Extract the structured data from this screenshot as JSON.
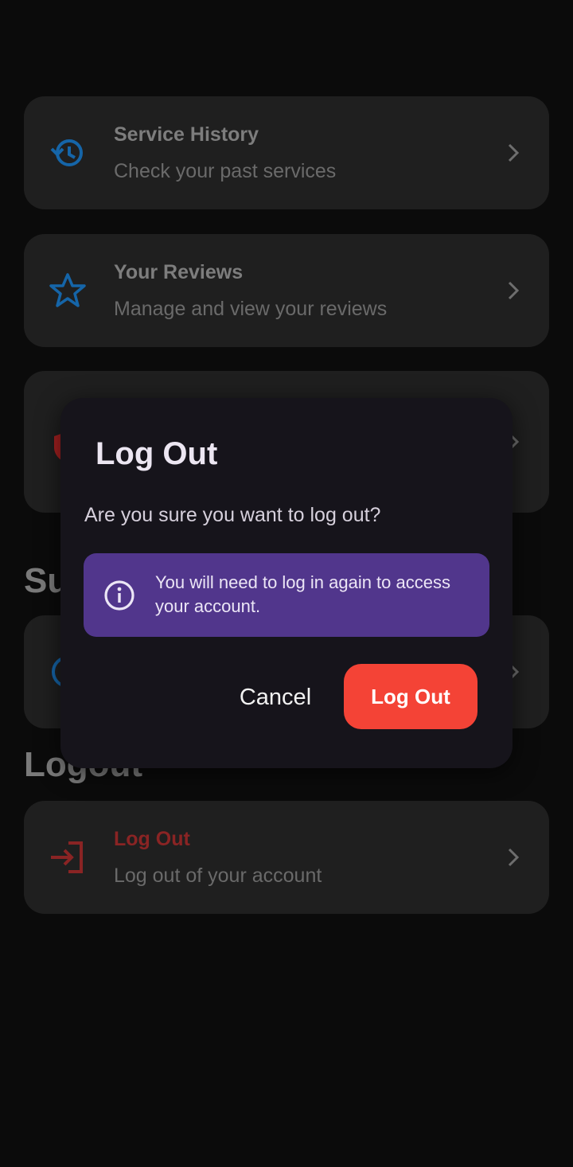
{
  "menu": {
    "service_history": {
      "title": "Service History",
      "subtitle": "Check your past services"
    },
    "reviews": {
      "title": "Your Reviews",
      "subtitle": "Manage and view your reviews"
    }
  },
  "sections": {
    "support_title_partial": "Su",
    "logout_title_partial": "Logout"
  },
  "logout_item": {
    "title": "Log Out",
    "subtitle": "Log out of your account"
  },
  "dialog": {
    "title": "Log Out",
    "message": "Are you sure you want to log out?",
    "info": "You will need to log in again to access your account.",
    "cancel_label": "Cancel",
    "confirm_label": "Log Out"
  },
  "colors": {
    "accent_blue": "#1565a8",
    "danger_red": "#f44336",
    "logout_red_dim": "#8a2424",
    "info_purple": "#51368c",
    "dialog_bg": "#16141b"
  },
  "icons": {
    "history": "history-icon",
    "star": "star-icon",
    "shield": "shield-icon",
    "help": "help-circle-icon",
    "logout": "login-arrow-icon",
    "chevron": "chevron-right-icon",
    "info": "info-icon"
  }
}
